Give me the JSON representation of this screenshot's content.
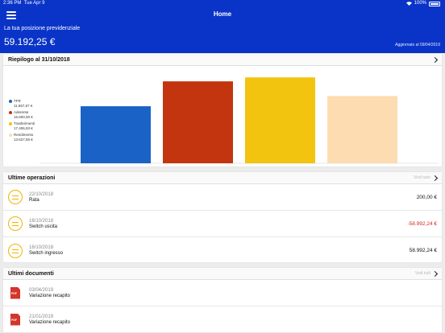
{
  "status_bar": {
    "time": "2:36 PM",
    "date": "Tue Apr 9",
    "battery": "100%"
  },
  "header": {
    "title": "Home",
    "position_label": "La tua posizione previdenziale",
    "position_value": "59.192,25 €",
    "updated": "Aggiornato al 09/04/2019"
  },
  "summary": {
    "title": "Riepilogo al 31/10/2018"
  },
  "chart_data": {
    "type": "bar",
    "categories": [
      "TFR",
      "Aderente",
      "Trasferimenti",
      "Rendimento"
    ],
    "values": [
      11557.67,
      16600.0,
      17406.93,
      13627.65
    ],
    "value_labels": [
      "11.557,67 €",
      "16.600,00 €",
      "17.406,93 €",
      "13.627,65 €"
    ],
    "colors": [
      "#1a62c6",
      "#c2350f",
      "#f2c410",
      "#fddcb1"
    ],
    "ylim": [
      0,
      17600
    ]
  },
  "operations": {
    "title": "Ultime operazioni",
    "see_all": "Vedi tutte",
    "items": [
      {
        "date": "22/10/2018",
        "name": "Rata",
        "amount": "200,00 €",
        "negative": false
      },
      {
        "date": "16/10/2018",
        "name": "Switch uscita",
        "amount": "-58.992,24 €",
        "negative": true
      },
      {
        "date": "16/10/2018",
        "name": "Switch ingresso",
        "amount": "58.992,24 €",
        "negative": false
      }
    ]
  },
  "documents": {
    "title": "Ultimi documenti",
    "see_all": "Vedi tutti",
    "pdf_label": "PDF",
    "items": [
      {
        "date": "03/04/2019",
        "name": "Variazione recapito"
      },
      {
        "date": "21/01/2019",
        "name": "Variazione recapito"
      }
    ]
  }
}
